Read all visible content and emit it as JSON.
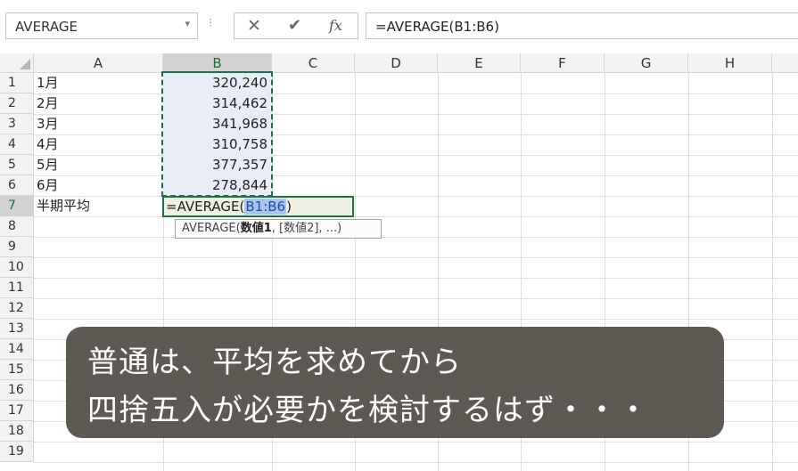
{
  "formula_bar": {
    "name_box": "AVERAGE",
    "name_box_arrow": "▾",
    "separator": "⁝",
    "cancel_icon": "✕",
    "enter_icon": "✔",
    "function_icon": "fx",
    "formula": "=AVERAGE(B1:B6)"
  },
  "sheet": {
    "columns": [
      "A",
      "B",
      "C",
      "D",
      "E",
      "F",
      "G",
      "H"
    ],
    "rows": [
      "1",
      "2",
      "3",
      "4",
      "5",
      "6",
      "7",
      "8",
      "9",
      "10",
      "11",
      "12",
      "13",
      "14",
      "15",
      "16",
      "17",
      "18",
      "19"
    ],
    "data": [
      {
        "label": "1月",
        "value": "320,240"
      },
      {
        "label": "2月",
        "value": "314,462"
      },
      {
        "label": "3月",
        "value": "341,968"
      },
      {
        "label": "4月",
        "value": "310,758"
      },
      {
        "label": "5月",
        "value": "377,357"
      },
      {
        "label": "6月",
        "value": "278,844"
      }
    ],
    "total_label": "半期平均",
    "edit_prefix": "=AVERAGE(",
    "edit_ref": "B1:B6",
    "edit_suffix": ")",
    "tooltip": {
      "func": "AVERAGE(",
      "arg1": "数値1",
      "rest": ", [数値2], ...)"
    }
  },
  "caption": {
    "line1": "普通は、平均を求めてから",
    "line2": "四捨五入が必要かを検討するはず・・・"
  }
}
